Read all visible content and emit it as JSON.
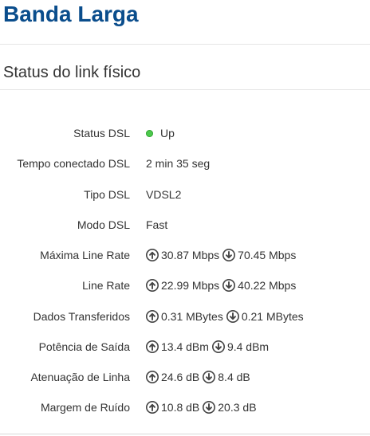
{
  "header": {
    "title": "Banda Larga"
  },
  "section": {
    "title": "Status do link físico"
  },
  "colors": {
    "title_blue": "#0a4d8c",
    "status_green": "#4cc94c"
  },
  "rows": {
    "status_dsl": {
      "label": "Status DSL",
      "value": "Up",
      "icon": "status-dot-green"
    },
    "tempo_conectado": {
      "label": "Tempo conectado DSL",
      "value": "2 min 35 seg"
    },
    "tipo_dsl": {
      "label": "Tipo DSL",
      "value": "VDSL2"
    },
    "modo_dsl": {
      "label": "Modo DSL",
      "value": "Fast"
    },
    "maxima_line_rate": {
      "label": "Máxima Line Rate",
      "up": "30.87 Mbps",
      "down": "70.45 Mbps"
    },
    "line_rate": {
      "label": "Line Rate",
      "up": "22.99 Mbps",
      "down": "40.22 Mbps"
    },
    "dados_transferidos": {
      "label": "Dados Transferidos",
      "up": "0.31 MBytes",
      "down": "0.21 MBytes"
    },
    "potencia_saida": {
      "label": "Potência de Saída",
      "up": "13.4 dBm",
      "down": "9.4 dBm"
    },
    "atenuacao_linha": {
      "label": "Atenuação de Linha",
      "up": "24.6 dB",
      "down": "8.4 dB"
    },
    "margem_ruido": {
      "label": "Margem de Ruído",
      "up": "10.8 dB",
      "down": "20.3 dB"
    }
  },
  "icons": {
    "up": "arrow-up-circle-icon",
    "down": "arrow-down-circle-icon"
  }
}
